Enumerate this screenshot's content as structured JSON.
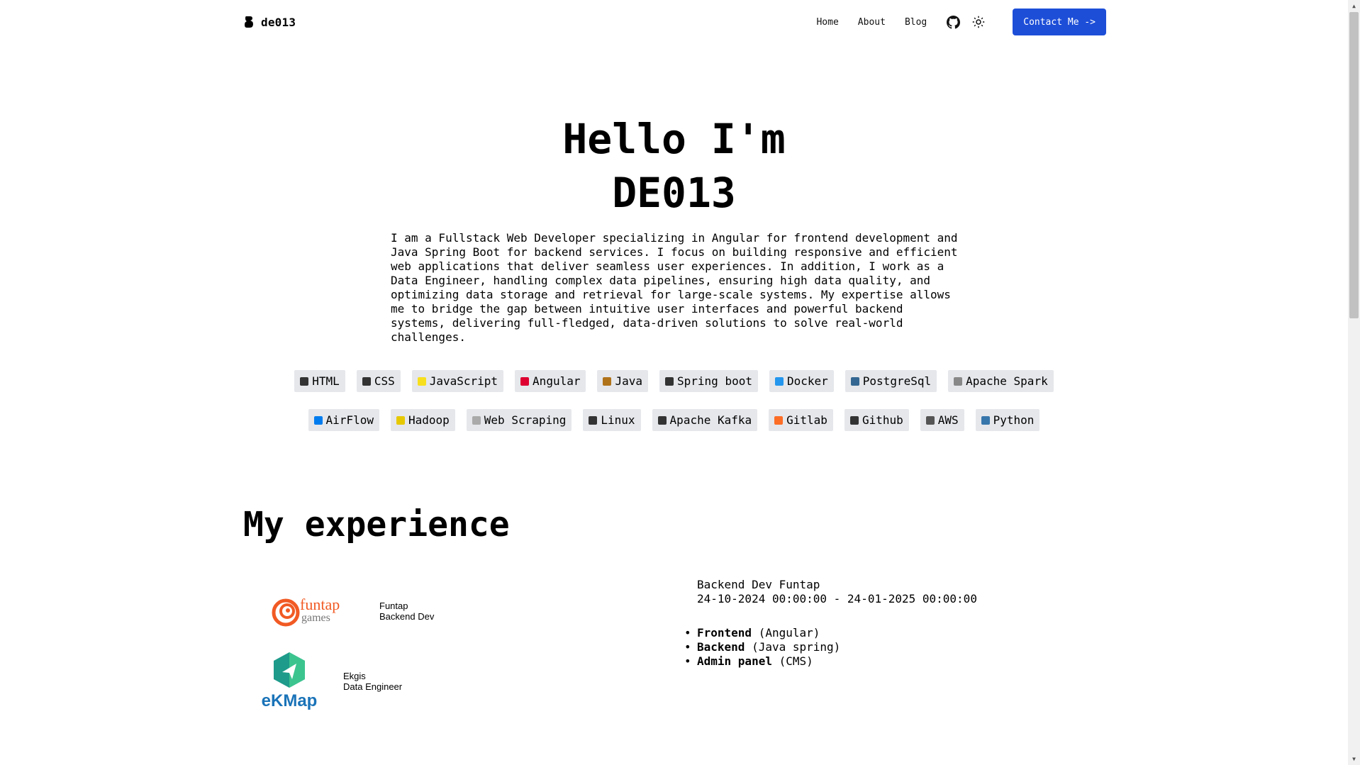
{
  "brand": {
    "name": "de013"
  },
  "nav": {
    "links": [
      "Home",
      "About",
      "Blog"
    ],
    "contact_label": "Contact Me ->"
  },
  "hero": {
    "title_line1": "Hello I'm",
    "title_line2": "DE013",
    "bio": "I am a Fullstack Web Developer specializing in Angular for frontend development and\nJava Spring Boot for backend services. I focus on building responsive and efficient\nweb applications that deliver seamless user experiences. In addition, I work as a\nData Engineer, handling complex data pipelines, ensuring high data quality, and\noptimizing data storage and retrieval for large-scale systems. My expertise allows\nme to bridge the gap between intuitive user interfaces and powerful backend\nsystems, delivering full-fledged, data-driven solutions to solve real-world\nchallenges."
  },
  "skills": {
    "row1": [
      {
        "label": "HTML",
        "icon": "html-icon",
        "color": "#333333"
      },
      {
        "label": "CSS",
        "icon": "css-icon",
        "color": "#333333"
      },
      {
        "label": "JavaScript",
        "icon": "javascript-icon",
        "color": "#f7df1e"
      },
      {
        "label": "Angular",
        "icon": "angular-icon",
        "color": "#dd0031"
      },
      {
        "label": "Java",
        "icon": "java-icon",
        "color": "#b07219"
      },
      {
        "label": "Spring boot",
        "icon": "spring-icon",
        "color": "#333333"
      },
      {
        "label": "Docker",
        "icon": "docker-icon",
        "color": "#2496ed"
      },
      {
        "label": "PostgreSql",
        "icon": "postgresql-icon",
        "color": "#336791"
      },
      {
        "label": "Apache Spark",
        "icon": "spark-icon",
        "color": "#888888"
      }
    ],
    "row2": [
      {
        "label": "AirFlow",
        "icon": "airflow-icon",
        "color": "#017cee"
      },
      {
        "label": "Hadoop",
        "icon": "hadoop-icon",
        "color": "#e6c800"
      },
      {
        "label": "Web Scraping",
        "icon": "web-scraping-icon",
        "color": "#aaaaaa"
      },
      {
        "label": "Linux",
        "icon": "linux-icon",
        "color": "#333333"
      },
      {
        "label": "Apache Kafka",
        "icon": "kafka-icon",
        "color": "#333333"
      },
      {
        "label": "Gitlab",
        "icon": "gitlab-icon",
        "color": "#fc6d26"
      },
      {
        "label": "Github",
        "icon": "github-icon",
        "color": "#333333"
      },
      {
        "label": "AWS",
        "icon": "aws-icon",
        "color": "#555555"
      },
      {
        "label": "Python",
        "icon": "python-icon",
        "color": "#3776ab"
      }
    ]
  },
  "experience": {
    "title": "My experience",
    "items": [
      {
        "company": "Funtap",
        "role": "Backend Dev",
        "logo_text_1": "funtap",
        "logo_text_2": "games"
      },
      {
        "company": "Ekgis",
        "role": "Data Engineer",
        "logo_text": "eKMap"
      }
    ],
    "detail": {
      "title": "Backend Dev Funtap",
      "dates": "24-10-2024 00:00:00 - 24-01-2025 00:00:00",
      "bullets": [
        {
          "bold": "Frontend",
          "rest": " (Angular)"
        },
        {
          "bold": "Backend",
          "rest": " (Java spring)"
        },
        {
          "bold": "Admin panel",
          "rest": " (CMS)"
        }
      ]
    }
  },
  "colors": {
    "accent": "#1d4ed8",
    "skill_bg": "#e5e7eb",
    "funtap_orange": "#f15a24",
    "ekmap_teal": "#1e9b8a"
  }
}
